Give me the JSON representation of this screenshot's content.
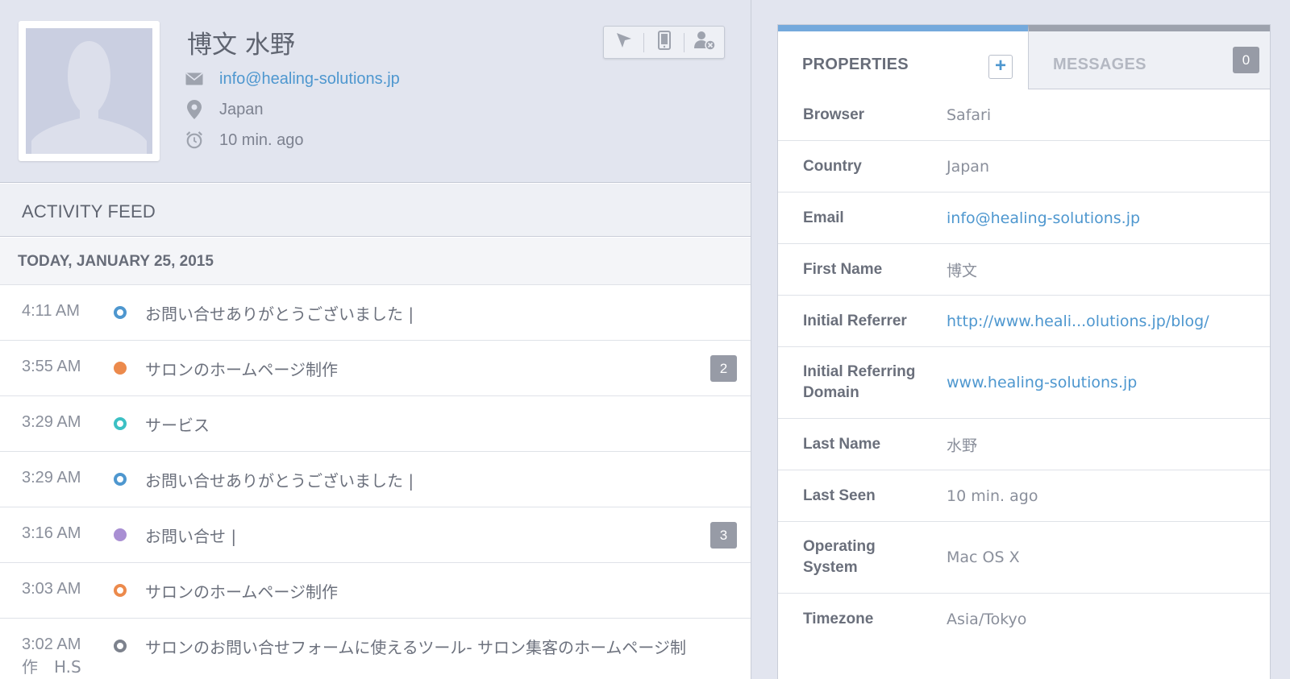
{
  "profile": {
    "name": "博文 水野",
    "email": "info@healing-solutions.jp",
    "location": "Japan",
    "last_seen": "10 min. ago"
  },
  "actions": [
    {
      "icon": "cursor-icon"
    },
    {
      "icon": "mobile-device-icon"
    },
    {
      "icon": "remove-user-icon"
    }
  ],
  "feed": {
    "title": "ACTIVITY FEED",
    "date": "TODAY, JANUARY 25, 2015",
    "items": [
      {
        "time": "4:11 AM",
        "text": "お問い合せありがとうございました |",
        "dot_color": "#4e97cf",
        "dot_style": "ring",
        "badge": null
      },
      {
        "time": "3:55 AM",
        "text": "サロンのホームページ制作",
        "dot_color": "#ec8a4c",
        "dot_style": "solid",
        "badge": "2"
      },
      {
        "time": "3:29 AM",
        "text": "サービス",
        "dot_color": "#3cc0c4",
        "dot_style": "ring",
        "badge": null
      },
      {
        "time": "3:29 AM",
        "text": "お問い合せありがとうございました |",
        "dot_color": "#4e97cf",
        "dot_style": "ring",
        "badge": null
      },
      {
        "time": "3:16 AM",
        "text": "お問い合せ |",
        "dot_color": "#a98fd3",
        "dot_style": "solid",
        "badge": "3"
      },
      {
        "time": "3:03 AM",
        "text": "サロンのホームページ制作",
        "dot_color": "#ec8a4c",
        "dot_style": "ring",
        "badge": null
      }
    ],
    "last_item": {
      "time": "3:02 AM",
      "text": "サロンのお問い合せフォームに使えるツール- サロン集客のホームページ制",
      "text_cont": "作　H.S",
      "dot_color": "#7d828d",
      "dot_style": "ring"
    }
  },
  "sidebar": {
    "tabs": {
      "properties": "PROPERTIES",
      "messages": "MESSAGES",
      "messages_count": "0",
      "add": "+"
    },
    "properties": [
      {
        "key": "Browser",
        "value": "Safari",
        "link": false
      },
      {
        "key": "Country",
        "value": "Japan",
        "link": false
      },
      {
        "key": "Email",
        "value": "info@healing-solutions.jp",
        "link": true
      },
      {
        "key": "First Name",
        "value": "博文",
        "link": false
      },
      {
        "key": "Initial Referrer",
        "value": "http://www.heali...olutions.jp/blog/",
        "link": true
      },
      {
        "key": "Initial Referring Domain",
        "value": "www.healing-solutions.jp",
        "link": true
      },
      {
        "key": "Last Name",
        "value": "水野",
        "link": false
      },
      {
        "key": "Last Seen",
        "value": "10 min. ago",
        "link": false
      },
      {
        "key": "Operating System",
        "value": "Mac OS X",
        "link": false
      },
      {
        "key": "Timezone",
        "value": "Asia/Tokyo",
        "link": false
      }
    ]
  },
  "colors": {
    "accent": "#4e97cf",
    "active_tab": "#74a9dc",
    "badge": "#979ba6"
  }
}
